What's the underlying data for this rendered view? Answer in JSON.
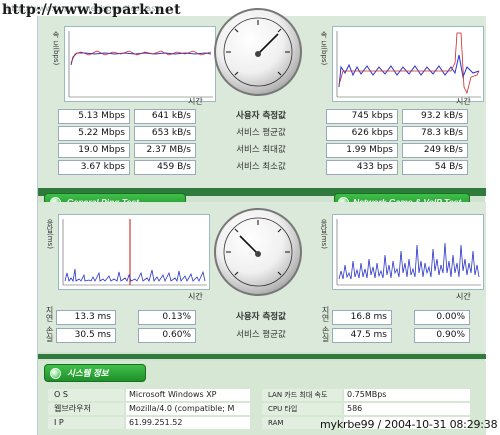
{
  "url_bar": {
    "url": "http://www.bcpark.net/speedtest.asp",
    "watermark": "http://www.bcpark.net"
  },
  "speed_section": {
    "y_axis_label": "속 도(bps)",
    "x_axis_label": "시간",
    "rows": [
      {
        "label": "사용자 측정값",
        "left_mbps": "5.13 Mbps",
        "left_kbs": "641 kB/s",
        "right_kbps": "745 kbps",
        "right_kbs": "93.2 kB/s"
      },
      {
        "label": "서비스 평균값",
        "left_mbps": "5.22 Mbps",
        "left_kbs": "653 kB/s",
        "right_kbps": "626 kbps",
        "right_kbs": "78.3 kB/s"
      },
      {
        "label": "서비스 최대값",
        "left_mbps": "19.0 Mbps",
        "left_kbs": "2.37 MB/s",
        "right_kbps": "1.99 Mbps",
        "right_kbs": "249 kB/s"
      },
      {
        "label": "서비스 최소값",
        "left_mbps": "3.67 kbps",
        "left_kbs": "459 B/s",
        "right_kbps": "433 bps",
        "right_kbs": "54 B/s"
      }
    ]
  },
  "buttons": {
    "ping": "General Ping Test",
    "game": "Network Game & VoIP Test",
    "system": "시스템 정보"
  },
  "ping_section": {
    "y_axis_label": "응답(ms)",
    "x_axis_label": "시간",
    "side_labels": [
      "지연",
      "손실"
    ],
    "rows": [
      {
        "label": "사용자 측정값",
        "left_ms": "13.3 ms",
        "left_pct": "0.13%",
        "right_ms": "16.8 ms",
        "right_pct": "0.00%"
      },
      {
        "label": "서비스 평균값",
        "left_ms": "30.5 ms",
        "left_pct": "0.60%",
        "right_ms": "47.5 ms",
        "right_pct": "0.90%"
      }
    ]
  },
  "system_info": {
    "left": [
      {
        "label": "O S",
        "value": "Microsoft Windows XP"
      },
      {
        "label": "웹브라우저",
        "value": "Mozilla/4.0 (compatible; M"
      },
      {
        "label": "I P",
        "value": "61.99.251.52"
      }
    ],
    "right": [
      {
        "label": "LAN 카드 최대 속도",
        "value": "0.75MBps"
      },
      {
        "label": "CPU 타입",
        "value": "586"
      },
      {
        "label": "RAM",
        "value": ""
      }
    ]
  },
  "footer_watermark": "mykrbe99 / 2004-10-31 08:29:38",
  "colors": {
    "accent_green": "#2f7a3c",
    "panel": "#dbe9da",
    "series_blue": "#2a34c8",
    "series_red": "#c82a2a"
  }
}
